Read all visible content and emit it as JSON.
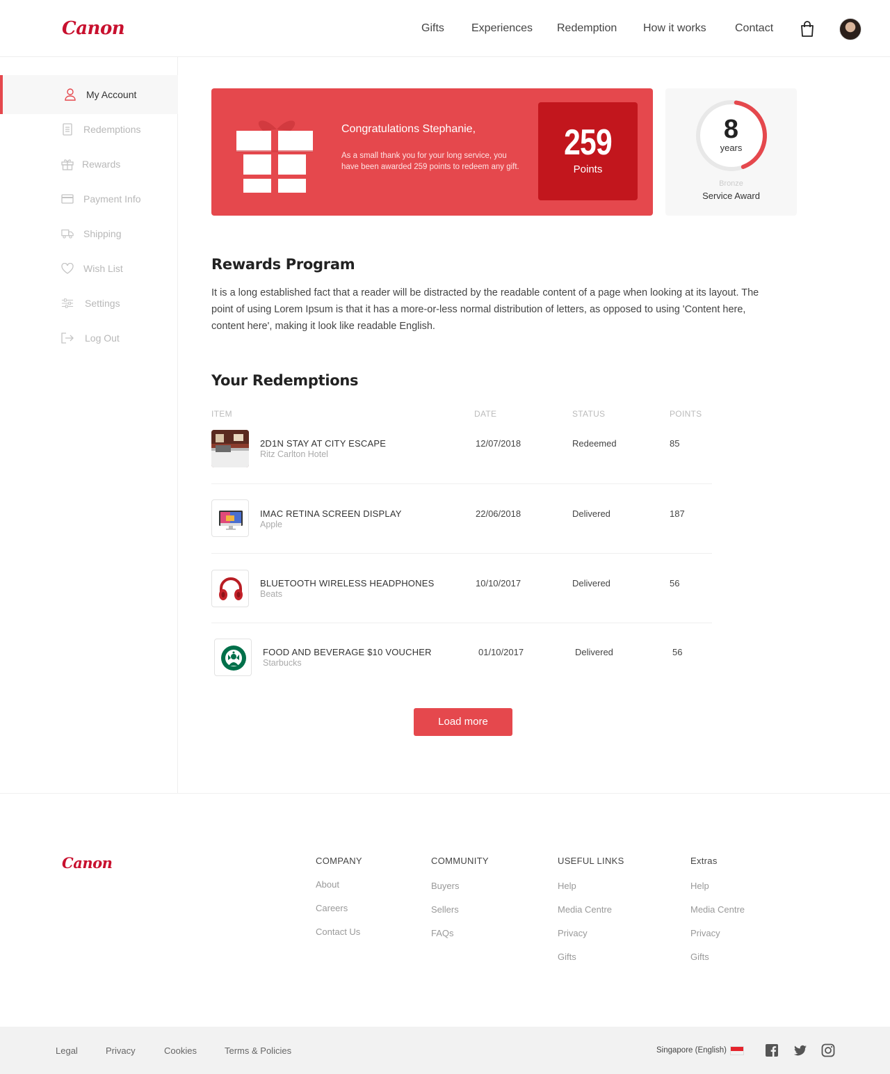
{
  "header": {
    "logo": "Canon",
    "nav": [
      "Gifts",
      "Experiences",
      "Redemption",
      "How it works",
      "Contact"
    ]
  },
  "sidebar": {
    "items": [
      {
        "label": "My Account",
        "icon": "user-icon"
      },
      {
        "label": "Redemptions",
        "icon": "document-icon"
      },
      {
        "label": "Rewards",
        "icon": "gift-icon"
      },
      {
        "label": "Payment Info",
        "icon": "credit-card-icon"
      },
      {
        "label": "Shipping",
        "icon": "truck-icon"
      },
      {
        "label": "Wish List",
        "icon": "heart-icon"
      },
      {
        "label": "Settings",
        "icon": "sliders-icon"
      },
      {
        "label": "Log Out",
        "icon": "logout-icon"
      }
    ]
  },
  "hero": {
    "title": "Congratulations Stephanie,",
    "message": "As a small thank you for your long service, you have been awarded 259 points to redeem any gift.",
    "points": "259",
    "points_label": "Points",
    "colors": {
      "background": "#e5484d",
      "points_box": "#c2161d"
    }
  },
  "award": {
    "years": "8",
    "years_label": "years",
    "tier": "Bronze",
    "name": "Service Award",
    "progress": 0.42
  },
  "rewards_program": {
    "heading": "Rewards Program",
    "body": "It is a long established fact that a reader will be distracted by the readable content of a page when looking at its layout. The point of using Lorem Ipsum is that it has a more-or-less normal distribution of letters, as opposed to using 'Content here, content here', making it look like readable English."
  },
  "redemptions": {
    "heading": "Your Redemptions",
    "columns": [
      "ITEM",
      "DATE",
      "STATUS",
      "POINTS"
    ],
    "rows": [
      {
        "name": "2D1N STAY AT CITY ESCAPE",
        "brand": "Ritz Carlton Hotel",
        "date": "12/07/2018",
        "status": "Redeemed",
        "points": "85",
        "thumb": "hotel-room-image"
      },
      {
        "name": "IMAC RETINA SCREEN DISPLAY",
        "brand": "Apple",
        "date": "22/06/2018",
        "status": "Delivered",
        "points": "187",
        "thumb": "imac-image"
      },
      {
        "name": "BLUETOOTH WIRELESS HEADPHONES",
        "brand": "Beats",
        "date": "10/10/2017",
        "status": "Delivered",
        "points": "56",
        "thumb": "headphones-image"
      },
      {
        "name": "FOOD AND BEVERAGE $10 VOUCHER",
        "brand": "Starbucks",
        "date": "01/10/2017",
        "status": "Delivered",
        "points": "56",
        "thumb": "starbucks-logo"
      }
    ],
    "load_more": "Load more"
  },
  "footer": {
    "logo": "Canon",
    "columns": [
      {
        "heading": "COMPANY",
        "links": [
          "About",
          "Careers",
          "Contact Us"
        ]
      },
      {
        "heading": "COMMUNITY",
        "links": [
          "Buyers",
          "Sellers",
          "FAQs"
        ]
      },
      {
        "heading": "USEFUL LINKS",
        "links": [
          "Help",
          "Media Centre",
          "Privacy",
          "Gifts"
        ]
      },
      {
        "heading": "Extras",
        "links": [
          "Help",
          "Media Centre",
          "Privacy",
          "Gifts"
        ]
      }
    ],
    "bottom_links": [
      "Legal",
      "Privacy",
      "Cookies",
      "Terms & Policies"
    ],
    "locale": "Singapore (English)",
    "social": [
      "facebook-icon",
      "twitter-icon",
      "instagram-icon"
    ]
  },
  "colors": {
    "accent": "#e5484d",
    "brand": "#c8102e"
  }
}
